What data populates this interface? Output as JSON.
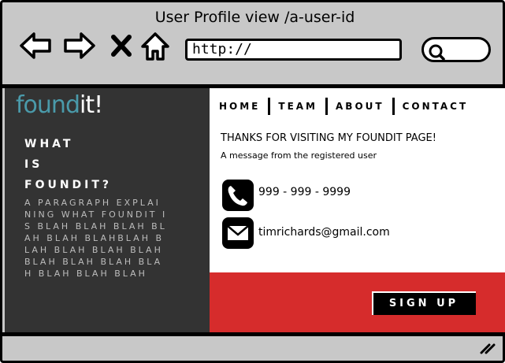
{
  "window": {
    "title": "User Profile view /a-user-id"
  },
  "toolbar": {
    "back_icon": "left-arrow-icon",
    "forward_icon": "right-arrow-icon",
    "stop_icon": "close-icon",
    "home_icon": "home-icon",
    "url": "http://",
    "search_icon": "search-icon"
  },
  "sidebar": {
    "logo_found": "found",
    "logo_it": "it!",
    "heading_line1": "WHAT",
    "heading_line2": "IS",
    "heading_line3": "FOUNDIT?",
    "paragraph": "A PARAGRAPH EXPLAINING WHAT FOUNDIT IS BLAH BLAH BLAH BLAH BLAH BLAHBLAH BLAH BLAH BLAH BLAH BLAH BLAH BLAH BLAH BLAH BLAH BLAH"
  },
  "nav": {
    "items": [
      "HOME",
      "TEAM",
      "ABOUT",
      "CONTACT"
    ]
  },
  "content": {
    "heading": "THANKS FOR VISITING MY FOUNDIT PAGE!",
    "subheading": "A message from the registered user",
    "phone_icon": "phone-icon",
    "phone": "999 - 999 - 9999",
    "email_icon": "envelope-icon",
    "email": "timrichards@gmail.com"
  },
  "cta": {
    "label": "SIGN UP"
  },
  "colors": {
    "brand": "#4a9aaa",
    "sidebar": "#333333",
    "cta_band": "#d62c2c",
    "chrome": "#c8c8c8"
  }
}
